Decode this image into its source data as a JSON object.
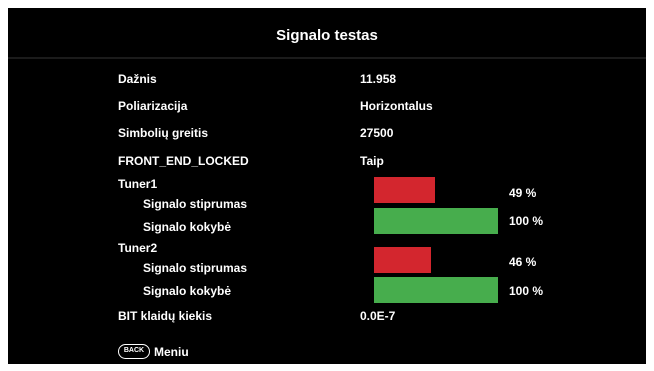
{
  "title": "Signalo testas",
  "rows": {
    "frequency": {
      "label": "Dažnis",
      "value": "11.958"
    },
    "polarization": {
      "label": "Poliarizacija",
      "value": "Horizontalus"
    },
    "symbol_rate": {
      "label": "Simbolių greitis",
      "value": "27500"
    },
    "front_end_locked": {
      "label": "FRONT_END_LOCKED",
      "value": "Taip"
    },
    "ber": {
      "label": "BIT klaidų kiekis",
      "value": "0.0E-7"
    }
  },
  "tuners": [
    {
      "name": "Tuner1",
      "strength": {
        "label": "Signalo stiprumas",
        "percent_text": "49 %",
        "level": 0.49,
        "color": "#d3262e"
      },
      "quality": {
        "label": "Signalo kokybė",
        "percent_text": "100 %",
        "level": 1.0,
        "color": "#47ad4d"
      }
    },
    {
      "name": "Tuner2",
      "strength": {
        "label": "Signalo stiprumas",
        "percent_text": "46 %",
        "level": 0.46,
        "color": "#d3262e"
      },
      "quality": {
        "label": "Signalo kokybė",
        "percent_text": "100 %",
        "level": 1.0,
        "color": "#47ad4d"
      }
    }
  ],
  "footer": {
    "back_key": "BACK",
    "menu_label": "Meniu"
  }
}
